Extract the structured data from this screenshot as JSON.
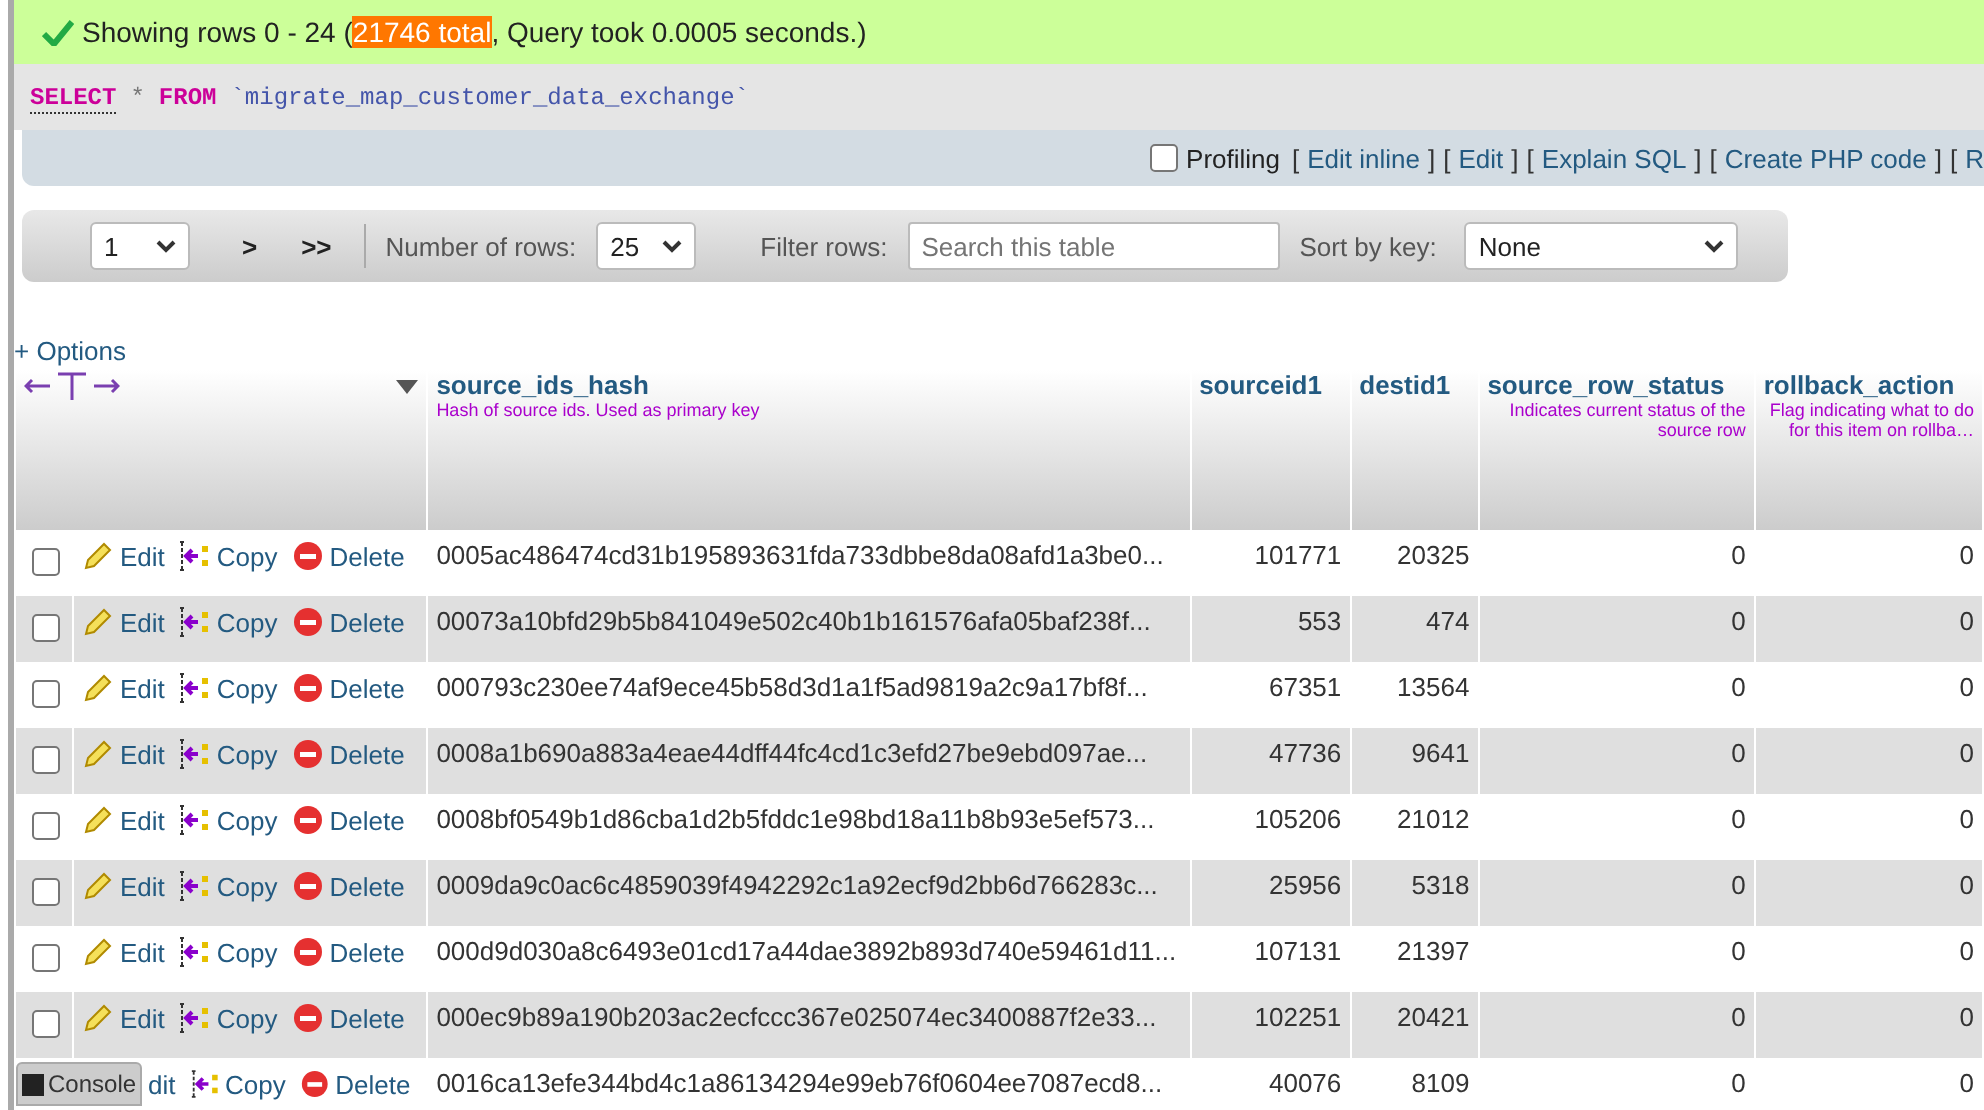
{
  "message": {
    "prefix": "Showing rows 0 - 24 (",
    "highlight": "21746 total",
    "suffix": ", Query took 0.0005 seconds.)"
  },
  "sql": [
    {
      "kind": "linked_keyword",
      "text": "SELECT"
    },
    {
      "kind": "plain",
      "text": "*"
    },
    {
      "kind": "keyword",
      "text": "FROM"
    },
    {
      "kind": "identifier",
      "text": "`migrate_map_customer_data_exchange`"
    }
  ],
  "profiling": {
    "label": "Profiling",
    "checked": false,
    "links": [
      {
        "open": "[",
        "label": "Edit inline",
        "close": "]"
      },
      {
        "open": "[",
        "label": "Edit",
        "close": "]"
      },
      {
        "open": "[",
        "label": "Explain SQL",
        "close": "]"
      },
      {
        "open": "[",
        "label": "Create PHP code",
        "close": "]"
      },
      {
        "open": "[",
        "label": "R"
      }
    ]
  },
  "navigation": {
    "page": "1",
    "next": ">",
    "last": ">>",
    "rows_label": "Number of rows:",
    "rows": "25",
    "filter_label": "Filter rows:",
    "filter_placeholder": "Search this table",
    "sort_label": "Sort by key:",
    "sort": "None"
  },
  "options_link": "+ Options",
  "columns": [
    {
      "name": "source_ids_hash",
      "comment": "Hash of source ids. Used as primary key",
      "kind": "text"
    },
    {
      "name": "sourceid1",
      "kind": "number"
    },
    {
      "name": "destid1",
      "kind": "number"
    },
    {
      "name": "source_row_status",
      "comment": "Indicates current status of the source row",
      "kind": "number"
    },
    {
      "name": "rollback_action",
      "comment": "Flag indicating what to do for this item on rollba…",
      "kind": "number"
    }
  ],
  "rows": [
    {
      "kind": "full",
      "checked": false,
      "edit": "Edit",
      "copy": "Copy",
      "delete": "Delete",
      "cells": [
        "0005ac486474cd31b195893631fda733dbbe8da08afd1a3be0...",
        "101771",
        "20325",
        "0",
        "0"
      ]
    },
    {
      "kind": "full",
      "checked": false,
      "edit": "Edit",
      "copy": "Copy",
      "delete": "Delete",
      "cells": [
        "00073a10bfd29b5b841049e502c40b1b161576afa05baf238f...",
        "553",
        "474",
        "0",
        "0"
      ]
    },
    {
      "kind": "full",
      "checked": false,
      "edit": "Edit",
      "copy": "Copy",
      "delete": "Delete",
      "cells": [
        "000793c230ee74af9ece45b58d3d1a1f5ad9819a2c9a17bf8f...",
        "67351",
        "13564",
        "0",
        "0"
      ]
    },
    {
      "kind": "full",
      "checked": false,
      "edit": "Edit",
      "copy": "Copy",
      "delete": "Delete",
      "cells": [
        "0008a1b690a883a4eae44dff44fc4cd1c3efd27be9ebd097ae...",
        "47736",
        "9641",
        "0",
        "0"
      ]
    },
    {
      "kind": "full",
      "checked": false,
      "edit": "Edit",
      "copy": "Copy",
      "delete": "Delete",
      "cells": [
        "0008bf0549b1d86cba1d2b5fddc1e98bd18a11b8b93e5ef573...",
        "105206",
        "21012",
        "0",
        "0"
      ]
    },
    {
      "kind": "full",
      "checked": false,
      "edit": "Edit",
      "copy": "Copy",
      "delete": "Delete",
      "cells": [
        "0009da9c0ac6c4859039f4942292c1a92ecf9d2bb6d766283c...",
        "25956",
        "5318",
        "0",
        "0"
      ]
    },
    {
      "kind": "full",
      "checked": false,
      "edit": "Edit",
      "copy": "Copy",
      "delete": "Delete",
      "cells": [
        "000d9d030a8c6493e01cd17a44dae3892b893d740e59461d11...",
        "107131",
        "21397",
        "0",
        "0"
      ]
    },
    {
      "kind": "full",
      "checked": false,
      "edit": "Edit",
      "copy": "Copy",
      "delete": "Delete",
      "cells": [
        "000ec9b89a190b203ac2ecfccc367e025074ec3400887f2e33...",
        "102251",
        "20421",
        "0",
        "0"
      ]
    },
    {
      "kind": "partial",
      "edit": "dit",
      "copy": "Copy",
      "delete": "Delete",
      "cells": [
        "0016ca13efe344bd4c1a86134294e99eb76f0604ee7087ecd8...",
        "40076",
        "8109",
        "0",
        "0"
      ]
    }
  ],
  "console": "Console"
}
